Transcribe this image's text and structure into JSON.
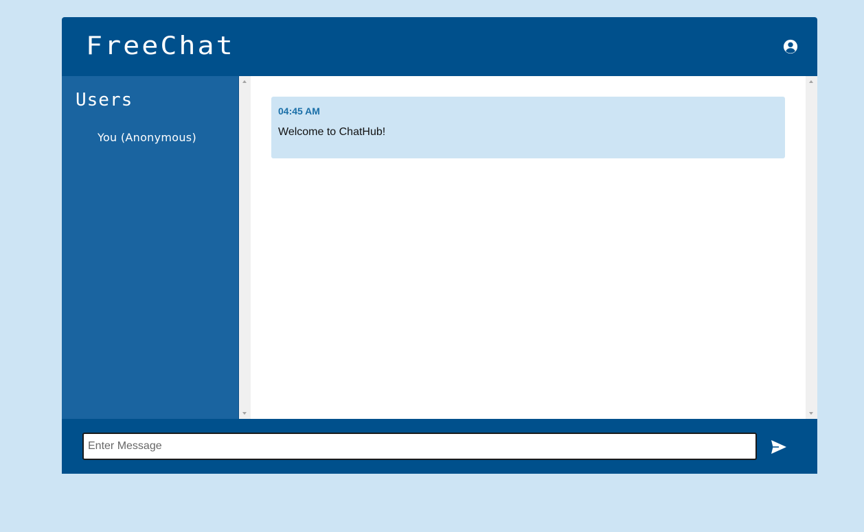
{
  "header": {
    "brand": "FreeChat",
    "account_icon": "account-circle-icon"
  },
  "sidebar": {
    "title": "Users",
    "users": [
      {
        "label": "You (Anonymous)"
      }
    ]
  },
  "chat": {
    "messages": [
      {
        "time": "04:45 AM",
        "text": "Welcome to ChatHub!"
      }
    ]
  },
  "composer": {
    "placeholder": "Enter Message",
    "value": "",
    "send_icon": "send-icon"
  },
  "colors": {
    "page_background": "#cde4f4",
    "header_background": "#00508c",
    "sidebar_background": "#1a64a0",
    "message_background": "#cde4f4",
    "timestamp": "#1a6fa8"
  }
}
